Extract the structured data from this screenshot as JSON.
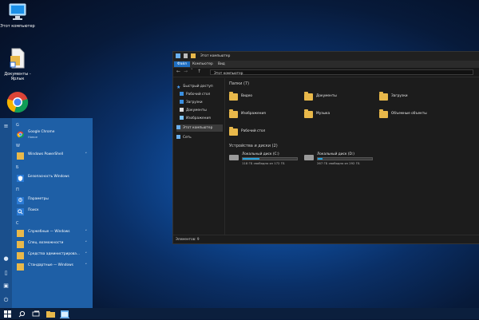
{
  "desktop": {
    "icons": [
      {
        "label": "Этот компьютер",
        "icon": "computer-icon"
      },
      {
        "label": "Документы - Ярлык",
        "icon": "documents-shortcut-icon"
      },
      {
        "label": "Google Chrome",
        "icon": "chrome-icon"
      }
    ]
  },
  "start_menu": {
    "rail_icons": [
      "hamburger-icon",
      "user-icon",
      "document-icon",
      "pictures-icon",
      "power-icon"
    ],
    "sections": [
      {
        "letter": "G",
        "items": [
          {
            "label": "Google Chrome",
            "sub": "Новое",
            "icon": "chrome-icon"
          }
        ]
      },
      {
        "letter": "W",
        "items": [
          {
            "label": "Windows PowerShell",
            "chevron": "˅",
            "icon": "folder-icon"
          }
        ]
      },
      {
        "letter": "Б",
        "items": [
          {
            "label": "Безопасность Windows",
            "icon": "shield-icon"
          }
        ]
      },
      {
        "letter": "П",
        "items": [
          {
            "label": "Параметры",
            "icon": "gear-icon"
          },
          {
            "label": "Поиск",
            "icon": "search-icon"
          }
        ]
      },
      {
        "letter": "С",
        "items": [
          {
            "label": "Служебные — Windows",
            "chevron": "˅",
            "icon": "folder-icon"
          },
          {
            "label": "Спец. возможности",
            "chevron": "˅",
            "icon": "folder-icon"
          },
          {
            "label": "Средства администрирова...",
            "chevron": "˅",
            "icon": "folder-icon"
          },
          {
            "label": "Стандартные — Windows",
            "chevron": "˅",
            "icon": "folder-icon"
          }
        ]
      }
    ]
  },
  "taskbar": {
    "items": [
      "windows-logo-icon",
      "search-icon",
      "task-view-icon",
      "file-explorer-icon",
      "explorer-window-icon"
    ]
  },
  "explorer": {
    "title": "Этот компьютер",
    "ribbon_tabs": [
      "Файл",
      "Компьютер",
      "Вид"
    ],
    "address": "Этот компьютер",
    "nav": {
      "quick_access": "Быстрый доступ",
      "quick_items": [
        "Рабочий стол",
        "Загрузки",
        "Документы",
        "Изображения"
      ],
      "this_pc": "Этот компьютер",
      "network": "Сеть"
    },
    "folders_header": "Папки (7)",
    "folders": [
      "Видео",
      "Документы",
      "Загрузки",
      "Изображения",
      "Музыка",
      "Объемные объекты",
      "Рабочий стол"
    ],
    "drives_header": "Устройства и диски (2)",
    "drives": [
      {
        "name": "Локальный диск (C:)",
        "free": "118 ГБ свободно из 172 ГБ",
        "used_fraction": 0.31
      },
      {
        "name": "Локальный диск (D:)",
        "free": "267 ГБ свободно из 292 ГБ",
        "used_fraction": 0.09
      }
    ],
    "status": "Элементов: 9"
  },
  "colors": {
    "start_bg": "#1e5fa6",
    "explorer_bg": "#1c1c1c",
    "folder": "#e8b84a",
    "drive_fill": "#26a0da"
  }
}
